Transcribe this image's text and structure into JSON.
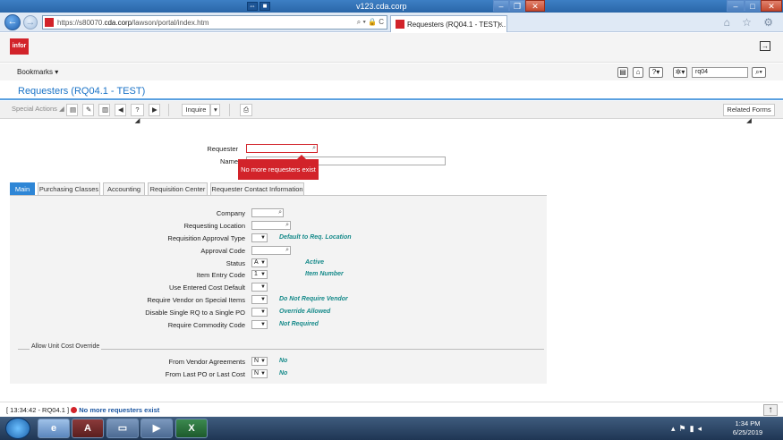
{
  "browser": {
    "window_title": "v123.cda.corp",
    "url_prefix": "https://s80070.",
    "url_domain": "cda.corp",
    "url_path": "/lawson/portal/index.htm",
    "url_controls": "⌕ ▾ 🔒 C",
    "tab_title": "Requesters (RQ04.1 - TEST)...",
    "tab_close": "×",
    "back_glyph": "←",
    "forward_glyph": "→",
    "nav_icons": "⌂ ☆ ⚙"
  },
  "app": {
    "logo_text": "infor",
    "bookmarks_label": "Bookmarks",
    "search_value": "rq04",
    "form_title": "Requesters (RQ04.1 - TEST)"
  },
  "toolbar": {
    "special_actions": "Special Actions",
    "inquire": "Inquire",
    "related_forms": "Related Forms"
  },
  "header": {
    "requester_label": "Requester",
    "requester_value": "",
    "name_label": "Name",
    "name_value": "",
    "error_tooltip": "No more requesters exist"
  },
  "tabs": [
    {
      "label": "Main",
      "active": true
    },
    {
      "label": "Purchasing Classes",
      "active": false
    },
    {
      "label": "Accounting",
      "active": false
    },
    {
      "label": "Requisition Center",
      "active": false
    },
    {
      "label": "Requester Contact Information",
      "active": false
    }
  ],
  "main": {
    "company": {
      "label": "Company",
      "value": ""
    },
    "requesting_location": {
      "label": "Requesting Location",
      "value": ""
    },
    "req_approval_type": {
      "label": "Requisition Approval Type",
      "value": "",
      "desc": "Default to Req. Location"
    },
    "approval_code": {
      "label": "Approval Code",
      "value": ""
    },
    "status": {
      "label": "Status",
      "value": "A",
      "desc": "Active"
    },
    "item_entry_code": {
      "label": "Item Entry Code",
      "value": "1",
      "desc": "Item Number"
    },
    "use_entered_cost": {
      "label": "Use Entered Cost Default",
      "value": ""
    },
    "require_vendor": {
      "label": "Require Vendor on Special Items",
      "value": "",
      "desc": "Do Not Require Vendor"
    },
    "disable_single_rq": {
      "label": "Disable Single RQ to a Single PO",
      "value": "",
      "desc": "Override Allowed"
    },
    "require_commodity": {
      "label": "Require Commodity Code",
      "value": "",
      "desc": "Not Required"
    },
    "group_label": "Allow Unit Cost Override",
    "from_vendor_agreements": {
      "label": "From Vendor Agreements",
      "value": "N",
      "desc": "No"
    },
    "from_last_po": {
      "label": "From Last PO or Last Cost",
      "value": "N",
      "desc": "No"
    }
  },
  "status_bar": {
    "prefix": "[ 13:34:42 - RQ04.1 ]",
    "message": "No more requesters exist"
  },
  "taskbar": {
    "time": "1:34 PM",
    "date": "6/25/2019"
  }
}
